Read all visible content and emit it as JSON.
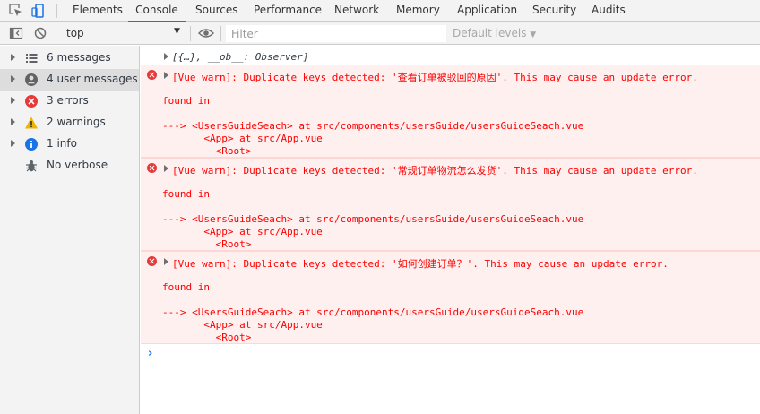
{
  "tabs": [
    {
      "label": "Elements",
      "active": false
    },
    {
      "label": "Console",
      "active": true
    },
    {
      "label": "Sources",
      "active": false
    },
    {
      "label": "Performance",
      "active": false
    },
    {
      "label": "Network",
      "active": false
    },
    {
      "label": "Memory",
      "active": false
    },
    {
      "label": "Application",
      "active": false
    },
    {
      "label": "Security",
      "active": false
    },
    {
      "label": "Audits",
      "active": false
    }
  ],
  "toolbar": {
    "context": "top",
    "filter_placeholder": "Filter",
    "levels": "Default levels"
  },
  "sidebar": {
    "items": [
      {
        "label": "6 messages",
        "icon": "list-icon",
        "expandable": true,
        "active": false
      },
      {
        "label": "4 user messages",
        "icon": "user-icon",
        "expandable": true,
        "active": true
      },
      {
        "label": "3 errors",
        "icon": "error-icon",
        "expandable": true,
        "active": false
      },
      {
        "label": "2 warnings",
        "icon": "warning-icon",
        "expandable": true,
        "active": false
      },
      {
        "label": "1 info",
        "icon": "info-icon",
        "expandable": true,
        "active": false
      },
      {
        "label": "No verbose",
        "icon": "bug-icon",
        "expandable": false,
        "active": false
      }
    ]
  },
  "console": {
    "object_line": "[{…}, __ob__: Observer]",
    "errors": [
      {
        "message": "[Vue warn]: Duplicate keys detected: '查看订单被驳回的原因'. This may cause an update error.",
        "found_in": "found in",
        "trace": [
          "---> <UsersGuideSeach> at src/components/usersGuide/usersGuideSeach.vue",
          "       <App> at src/App.vue",
          "         <Root>"
        ]
      },
      {
        "message": "[Vue warn]: Duplicate keys detected: '常规订单物流怎么发货'. This may cause an update error.",
        "found_in": "found in",
        "trace": [
          "---> <UsersGuideSeach> at src/components/usersGuide/usersGuideSeach.vue",
          "       <App> at src/App.vue",
          "         <Root>"
        ]
      },
      {
        "message": "[Vue warn]: Duplicate keys detected: '如何创建订单？'. This may cause an update error.",
        "found_in": "found in",
        "trace": [
          "---> <UsersGuideSeach> at src/components/usersGuide/usersGuideSeach.vue",
          "       <App> at src/App.vue",
          "         <Root>"
        ]
      }
    ],
    "prompt": "›"
  },
  "colors": {
    "error_text": "#ff0000",
    "error_bg": "#fff0f0",
    "accent": "#1a73e8"
  }
}
